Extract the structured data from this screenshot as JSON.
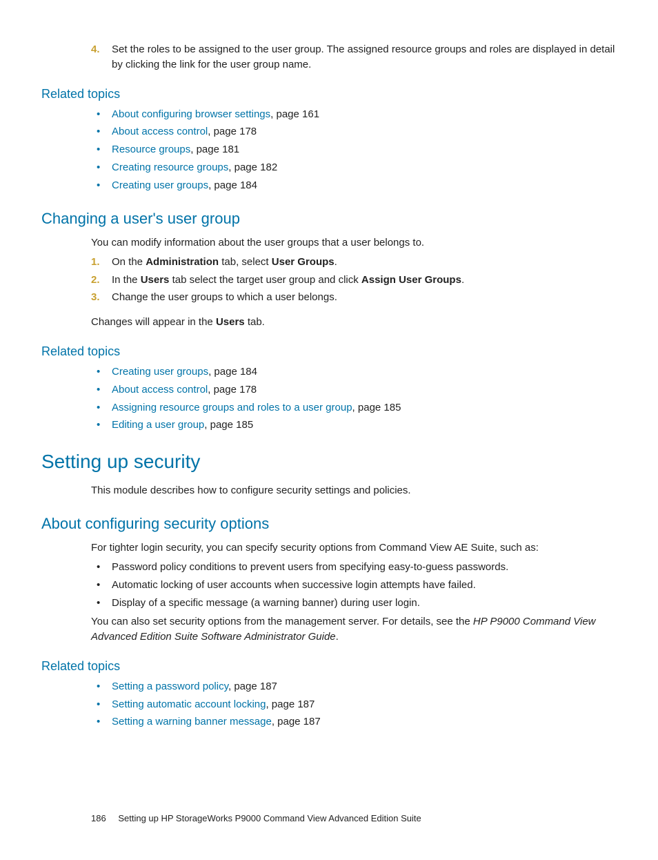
{
  "step4": {
    "num": "4.",
    "text": "Set the roles to be assigned to the user group. The assigned resource groups and roles are displayed in detail by clicking the link for the user group name."
  },
  "rt1": {
    "heading": "Related topics",
    "items": [
      {
        "link": "About configuring browser settings",
        "suffix": ", page 161"
      },
      {
        "link": "About access control",
        "suffix": ", page 178"
      },
      {
        "link": "Resource groups",
        "suffix": ", page 181"
      },
      {
        "link": "Creating resource groups",
        "suffix": ", page 182"
      },
      {
        "link": "Creating user groups",
        "suffix": ", page 184"
      }
    ]
  },
  "sec1": {
    "heading": "Changing a user's user group",
    "intro": "You can modify information about the user groups that a user belongs to.",
    "s1": {
      "num": "1.",
      "a": "On the ",
      "b": "Administration",
      "c": " tab, select  ",
      "d": "User Groups",
      "e": "."
    },
    "s2": {
      "num": "2.",
      "a": "In the ",
      "b": "Users",
      "c": " tab select the target user group and click ",
      "d": "Assign User Groups",
      "e": "."
    },
    "s3": {
      "num": "3.",
      "a": "Change the user groups to which a user belongs."
    },
    "outro_a": "Changes will appear in the ",
    "outro_b": "Users",
    "outro_c": " tab."
  },
  "rt2": {
    "heading": "Related topics",
    "items": [
      {
        "link": "Creating user groups",
        "suffix": ", page 184"
      },
      {
        "link": "About access control",
        "suffix": ", page 178"
      },
      {
        "link": "Assigning resource groups and roles to a user group",
        "suffix": ", page 185"
      },
      {
        "link": "Editing a user group",
        "suffix": ", page 185"
      }
    ]
  },
  "sec2": {
    "heading": "Setting up security",
    "intro": "This module describes how to configure security settings and policies."
  },
  "sec3": {
    "heading": "About configuring security options",
    "intro": "For tighter login security, you can specify security options from Command View AE Suite, such as:",
    "bullets": [
      "Password policy conditions to prevent users from specifying easy-to-guess passwords.",
      "Automatic locking of user accounts when successive login attempts have failed.",
      "Display of a specific message (a warning banner) during user login."
    ],
    "outro_a": "You can also set security options from the management server. For details, see the ",
    "outro_b": "HP P9000 Command View Advanced Edition Suite Software Administrator Guide",
    "outro_c": "."
  },
  "rt3": {
    "heading": "Related topics",
    "items": [
      {
        "link": "Setting a password policy",
        "suffix": ", page 187"
      },
      {
        "link": "Setting automatic account locking",
        "suffix": ", page 187"
      },
      {
        "link": "Setting a warning banner message",
        "suffix": ", page 187"
      }
    ]
  },
  "footer": {
    "page": "186",
    "text": "Setting up HP StorageWorks P9000 Command View Advanced Edition Suite"
  }
}
